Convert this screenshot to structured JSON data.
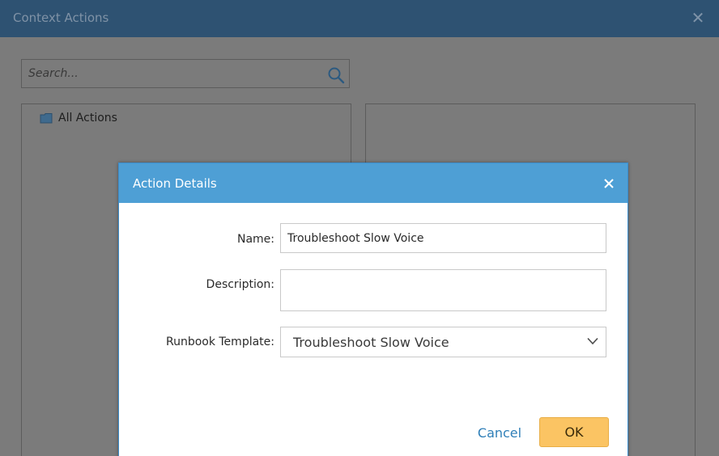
{
  "outer_dialog": {
    "title": "Context Actions",
    "close_glyph": "✕",
    "search": {
      "placeholder": "Search...",
      "value": ""
    },
    "tree": {
      "root_label": "All Actions"
    }
  },
  "action_dialog": {
    "title": "Action Details",
    "fields": {
      "name_label": "Name:",
      "name_value": "Troubleshoot Slow Voice",
      "description_label": "Description:",
      "description_value": "",
      "runbook_label": "Runbook Template:",
      "runbook_value": "Troubleshoot Slow Voice"
    },
    "buttons": {
      "cancel_label": "Cancel",
      "ok_label": "OK"
    }
  },
  "colors": {
    "outer_header": "#2e5272",
    "modal_header": "#4e9fd5",
    "ok_button": "#fbc463",
    "link": "#2f7fb8"
  },
  "icons": [
    "search-icon",
    "folder-icon",
    "close-icon",
    "chevron-down-icon"
  ]
}
